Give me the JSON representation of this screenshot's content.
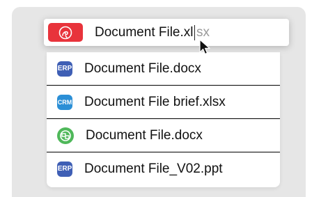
{
  "search": {
    "typed_text": "Document File.xl",
    "completion_text": "sx",
    "app_icon": "red-swirl-app-icon"
  },
  "results": [
    {
      "badge": "ERP",
      "badge_color": "#3f5fb5",
      "label": "Document File.docx"
    },
    {
      "badge": "CRM",
      "badge_color": "#2b8fd6",
      "label": "Document File brief.xlsx"
    },
    {
      "badge": "",
      "badge_icon": "green-network-icon",
      "badge_color": "#4fb85a",
      "label": "Document File.docx"
    },
    {
      "badge": "ERP",
      "badge_color": "#3f5fb5",
      "label": "Document File_V02.ppt"
    }
  ],
  "colors": {
    "panel_background": "#e6e6e6",
    "app_icon_red": "#e8333b"
  },
  "pointer": "arrow-cursor-icon"
}
